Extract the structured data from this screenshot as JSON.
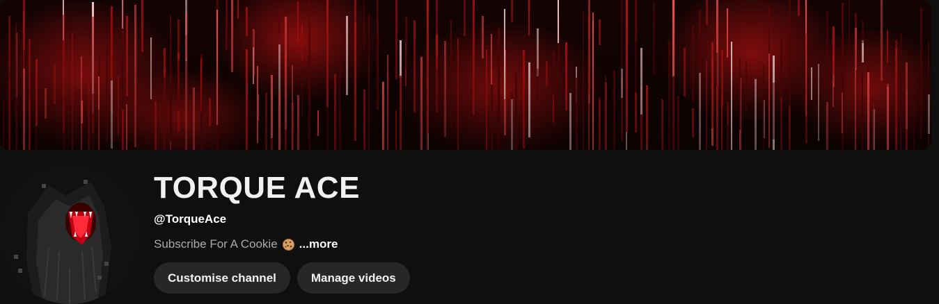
{
  "channel": {
    "name": "TORQUE ACE",
    "handle": "@TorqueAce",
    "description": "Subscribe For A Cookie",
    "description_emoji": "cookie-icon",
    "more_label": "...more"
  },
  "actions": {
    "customise_label": "Customise channel",
    "manage_label": "Manage videos"
  },
  "banner": {
    "theme": "red matrix code rain",
    "colors": {
      "base": "#120202",
      "rain": "#d01818",
      "highlight": "#ff6a6a"
    }
  },
  "colors": {
    "background": "#0f0f0f",
    "button_bg": "#272727",
    "text_primary": "#f1f1f1",
    "text_secondary": "#aaaaaa"
  }
}
